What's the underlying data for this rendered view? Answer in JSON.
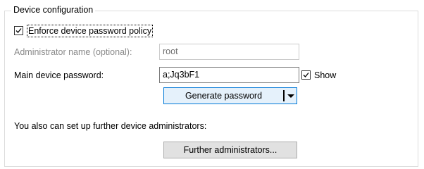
{
  "group": {
    "title": "Device configuration"
  },
  "enforce_policy": {
    "label": "Enforce device password policy",
    "checked": true
  },
  "admin_name": {
    "label": "Administrator name (optional):",
    "value": "root",
    "enabled": false
  },
  "password": {
    "label": "Main device password:",
    "value": "a;Jq3bF1"
  },
  "show": {
    "label": "Show",
    "checked": true
  },
  "generate": {
    "label": "Generate password",
    "icon": "chevron-down-icon"
  },
  "further": {
    "text": "You also can set up further device administrators:",
    "button_label": "Further administrators..."
  }
}
